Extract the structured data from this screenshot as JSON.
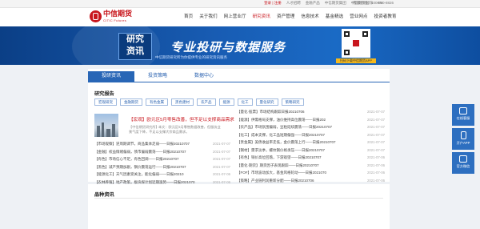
{
  "topbar": {
    "links": [
      "登录 | 注册",
      "人才招聘",
      "金融产品",
      "中信期货集团",
      "中信期货国际",
      "EN"
    ],
    "hotline": "客服热线：400-990-8826"
  },
  "header": {
    "logo_cn": "中信期货",
    "logo_en": "CITIC Futures",
    "nav": [
      "首页",
      "关于我们",
      "网上营业厅",
      "研究资讯",
      "资产管理",
      "信息技术",
      "基金精选",
      "营业网点",
      "投资者教育"
    ],
    "active": "研究资讯"
  },
  "banner": {
    "tag_line1": "研究",
    "tag_line2": "资讯",
    "headline": "专业投研与数据服务",
    "sub": "中信期货研究所为你提供专业的研究资讯服务",
    "qr_label": "扫码下载中信期货APP"
  },
  "tabs": [
    "投研资讯",
    "投资策略",
    "数据中心"
  ],
  "research": {
    "title": "研究报告",
    "cats": [
      "宏观研究",
      "金融期货",
      "有色金属",
      "黑色建材",
      "农产品",
      "能源",
      "化工",
      "量化研究",
      "策略研究"
    ]
  },
  "featured": {
    "title": "【宏观】欧元区5月零售改善，但不足以支撑商品需求",
    "desc": "【中信期货研究所】·本文：欧元区5月零售数据改善，但服务业景气度下降，不足以支撑大宗商品需求。"
  },
  "left_list": [
    {
      "title": "【市场观察】逆周期调节，商品集体走弱——日报20210707",
      "date": "2021-07-07"
    },
    {
      "title": "【金融】权益情绪偏弱，债市偏弱震荡——日报20210707",
      "date": "2021-07-07"
    },
    {
      "title": "【有色】市场信心不足，有色回调——日报20210707",
      "date": "2021-07-07"
    },
    {
      "title": "【黑色】减产预期加剧，钢价震荡运行——日报20210707",
      "date": "2021-07-07"
    },
    {
      "title": "【能源化工】天气因素受关注，能化偏弱——日报20210",
      "date": "2021-07-06"
    },
    {
      "title": "【农林养殖】地产政策，板块探计划近期涨势——日报2021070",
      "date": "2021-07-06"
    }
  ],
  "right_list": [
    {
      "title": "【量化·股票】市场结构跟踪日报20210706",
      "date": "2021-07-07"
    },
    {
      "title": "【能源】供需格局支撑，油价维持高位震荡——日报202",
      "date": "2021-07-07"
    },
    {
      "title": "【农产品】市场氛围偏弱，豆粕延续震荡——日报20210707",
      "date": "2021-07-07"
    },
    {
      "title": "【化工】成本支撑，化工品短期偏强——日报20210707",
      "date": "2021-07-07"
    },
    {
      "title": "【贵金属】美债收益率走低，金价震荡上行——日报20210707",
      "date": "2021-07-07"
    },
    {
      "title": "【钢材】需求淡季，螺纹钢价格承压——日报20210707",
      "date": "2021-07-07"
    },
    {
      "title": "【有色】铜价高位回落，下游观望——日报20210707",
      "date": "2021-07-06"
    },
    {
      "title": "【量化·期货】期货因子表现跟踪——日报20210707",
      "date": "2021-07-06"
    },
    {
      "title": "【FOF】市场波动加大，基金风格轮动——日报2021070",
      "date": "2021-07-06"
    },
    {
      "title": "【策略】产业链利润重新分配——日报20210706",
      "date": "2021-07-06"
    },
    {
      "title": "【金融】国债期货偏强运行——日报20210706",
      "date": "2021-07-06"
    }
  ],
  "second_section": {
    "title": "品种资讯"
  },
  "side_widgets": [
    "在线客服",
    "开户APP",
    "官方微信"
  ]
}
